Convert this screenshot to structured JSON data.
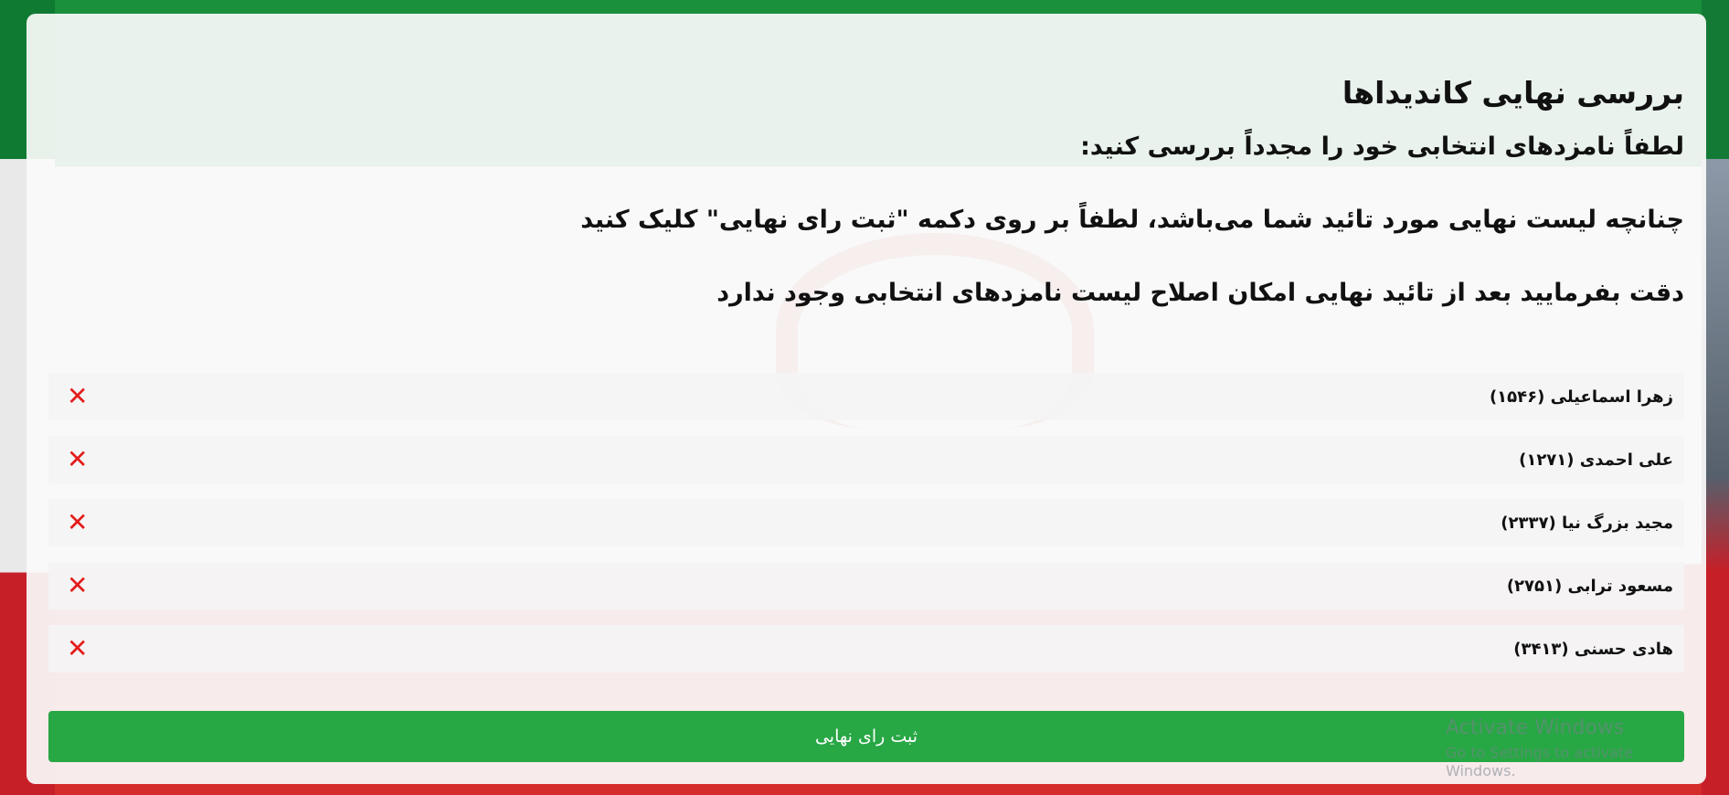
{
  "page": {
    "title": "بررسی نهایی کاندیداها",
    "instructions": [
      "لطفاً نامزدهای انتخابی خود را مجدداً بررسی کنید:",
      "چنانچه لیست نهایی مورد تائید شما می‌باشد، لطفاً بر روی دکمه \"ثبت رای نهایی\" کلیک کنید",
      "دقت بفرمایید بعد از تائید نهایی امکان اصلاح لیست نامزدهای انتخابی وجود ندارد"
    ]
  },
  "candidates": [
    {
      "label": "زهرا اسماعیلی (۱۵۴۶)",
      "remove_icon": "✕"
    },
    {
      "label": "علی احمدی (۱۲۷۱)",
      "remove_icon": "✕"
    },
    {
      "label": "مجید بزرگ نیا (۲۳۳۷)",
      "remove_icon": "✕"
    },
    {
      "label": "مسعود ترابی (۲۷۵۱)",
      "remove_icon": "✕"
    },
    {
      "label": "هادی حسنی (۳۴۱۳)",
      "remove_icon": "✕"
    }
  ],
  "actions": {
    "submit_label": "ثبت رای نهایی"
  },
  "watermark": {
    "title": "Activate Windows",
    "subtitle": "Go to Settings to activate Windows."
  },
  "colors": {
    "submit_bg": "#28a745",
    "remove_icon": "#e31b1b",
    "flag_green": "#1a8f3c",
    "flag_red": "#d62b2b"
  }
}
